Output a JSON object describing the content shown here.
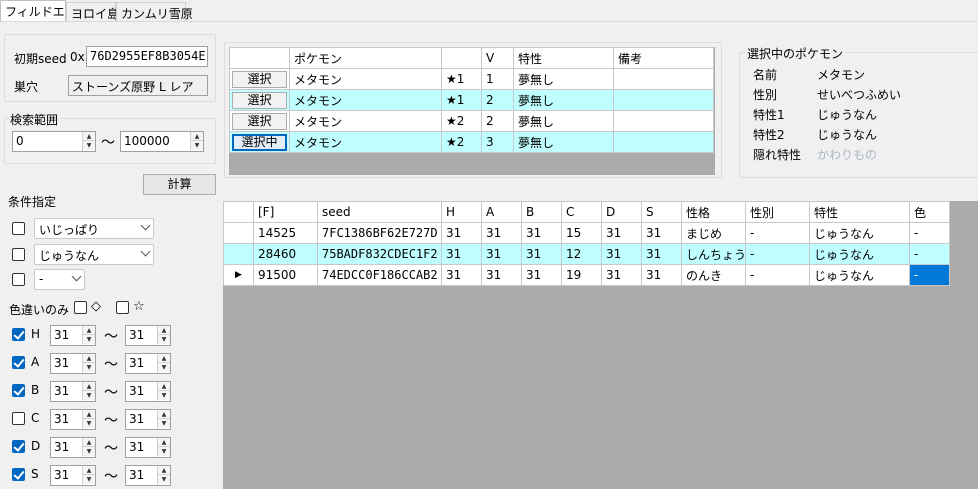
{
  "tabs": [
    "フィルドエリア",
    "ヨロイ島",
    "カンムリ雪原"
  ],
  "seed_label": "初期seed",
  "seed_prefix": "0x",
  "seed_value": "76D2955EF8B3054E",
  "nest_label": "巣穴",
  "nest_value": "ストーンズ原野 L レア",
  "range_label": "検索範囲",
  "range_from": "0",
  "range_tilde": "〜",
  "range_to": "100000",
  "calc_button": "計算",
  "cond_label": "条件指定",
  "nature_select": "いじっぱり",
  "ability_select": "じゅうなん",
  "gender_select": "-",
  "shiny_label": "色違いのみ",
  "shiny_diamond": "◇",
  "shiny_star": "☆",
  "iv_filters": [
    {
      "stat": "H",
      "checked": true,
      "min": "31",
      "max": "31"
    },
    {
      "stat": "A",
      "checked": true,
      "min": "31",
      "max": "31"
    },
    {
      "stat": "B",
      "checked": true,
      "min": "31",
      "max": "31"
    },
    {
      "stat": "C",
      "checked": false,
      "min": "31",
      "max": "31"
    },
    {
      "stat": "D",
      "checked": true,
      "min": "31",
      "max": "31"
    },
    {
      "stat": "S",
      "checked": true,
      "min": "31",
      "max": "31"
    }
  ],
  "poke_table": {
    "headers": [
      "",
      "ポケモン",
      "",
      "V",
      "特性",
      "備考"
    ],
    "rows": [
      {
        "button": "選択",
        "name": "メタモン",
        "rank": "★1",
        "v": "1",
        "ability": "夢無し",
        "note": ""
      },
      {
        "button": "選択",
        "name": "メタモン",
        "rank": "★1",
        "v": "2",
        "ability": "夢無し",
        "note": ""
      },
      {
        "button": "選択",
        "name": "メタモン",
        "rank": "★2",
        "v": "2",
        "ability": "夢無し",
        "note": ""
      },
      {
        "button": "選択中",
        "name": "メタモン",
        "rank": "★2",
        "v": "3",
        "ability": "夢無し",
        "note": ""
      }
    ]
  },
  "selected": {
    "title": "選択中のポケモン",
    "name_label": "名前",
    "name": "メタモン",
    "gender_label": "性別",
    "gender": "せいべつふめい",
    "ability1_label": "特性1",
    "ability1": "じゅうなん",
    "ability2_label": "特性2",
    "ability2": "じゅうなん",
    "hidden_label": "隠れ特性",
    "hidden": "かわりもの"
  },
  "results": {
    "headers": [
      "",
      "[F]",
      "seed",
      "H",
      "A",
      "B",
      "C",
      "D",
      "S",
      "性格",
      "性別",
      "特性",
      "色"
    ],
    "rows": [
      [
        "",
        "14525",
        "7FC1386BF62E727D",
        "31",
        "31",
        "31",
        "15",
        "31",
        "31",
        "まじめ",
        "-",
        "じゅうなん",
        "-"
      ],
      [
        "",
        "28460",
        "75BADF832CDEC1F2",
        "31",
        "31",
        "31",
        "12",
        "31",
        "31",
        "しんちょう",
        "-",
        "じゅうなん",
        "-"
      ],
      [
        "▶",
        "91500",
        "74EDCC0F186CCAB2",
        "31",
        "31",
        "31",
        "19",
        "31",
        "31",
        "のんき",
        "-",
        "じゅうなん",
        "-"
      ]
    ]
  },
  "colors": {
    "row_highlight": "#c0ffff",
    "selection": "#0078d7",
    "empty_area": "#ababab"
  }
}
